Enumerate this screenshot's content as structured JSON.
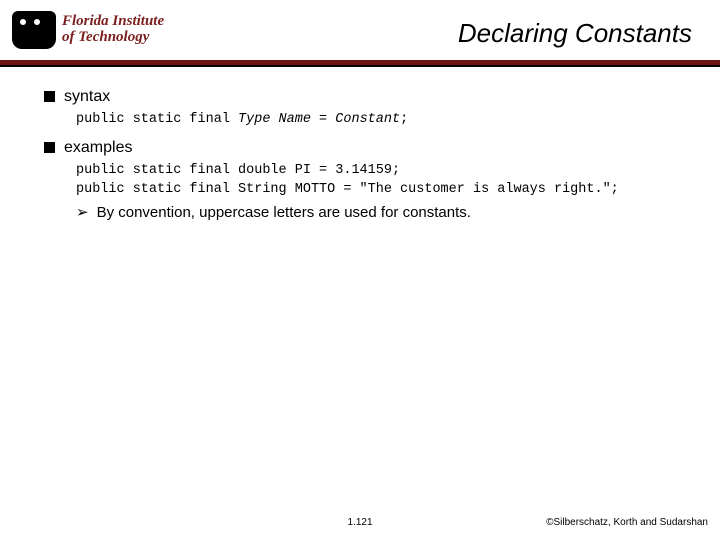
{
  "header": {
    "logo_line1": "Florida Institute",
    "logo_line2": "of Technology",
    "title": "Declaring Constants"
  },
  "content": {
    "bullet1_label": "syntax",
    "syntax_prefix": "public static final ",
    "syntax_type": "Type Name",
    "syntax_eq": " = ",
    "syntax_const": "Constant",
    "syntax_semi": ";",
    "bullet2_label": "examples",
    "example1": "public static final double PI = 3.14159;",
    "example2": "public static final String MOTTO = \"The customer is always right.\";",
    "note": "By convention, uppercase letters are used for constants."
  },
  "footer": {
    "page": "1.121",
    "copyright": "©Silberschatz, Korth and Sudarshan"
  }
}
